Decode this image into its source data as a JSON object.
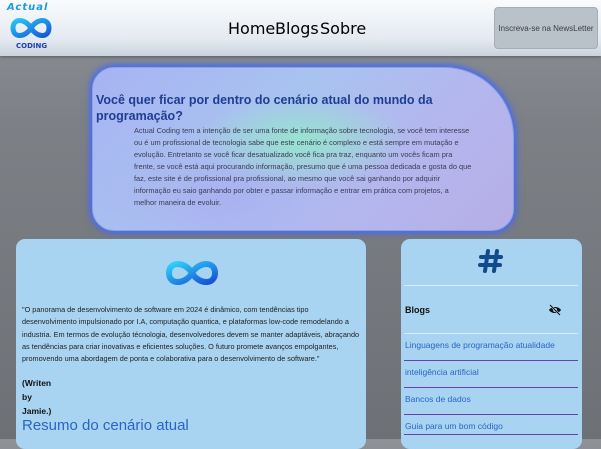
{
  "brand": {
    "name_top": "Actual",
    "name_bottom": "CODING"
  },
  "nav": {
    "home": "Home",
    "blogs": "Blogs",
    "sobre": "Sobre"
  },
  "newsletter_button": "Inscreva-se na NewsLetter",
  "hero": {
    "title": "Você quer ficar por dentro do cenário atual do mundo da programação?",
    "text": "Actual Coding tem a intenção de ser uma fonte de informação sobre tecnologia, se você tem interesse ou é um profissional de tecnologia sabe que este cenário é complexo e está sempre em mutação e evolução. Entretanto se você ficar desatualizado você fica pra traz, enquanto um vocês ficam pra frente, se você está aqui procurando informação, presumo que é uma pessoa dedicada e gosta do que faz, este site é de profissional pra profissional, ao mesmo que você sai ganhando por adquirir informação eu saio ganhando por obter e passar informação e entrar em prática com projetos, a melhor maneira de evoluir."
  },
  "article": {
    "quote": "\"O panorama de desenvolvimento de software em 2024 é dinâmico, com tendências tipo desenvolvimento impulsionado por I.A, computação quantica, e plataformas low-code remodelando a industria. Em termos de evolução técnologia, desenvolvedores devem se manter adaptáveis, abraçando as tendências para criar inovativas e eficientes soluções. O futuro promete avanços empolgantes, promovendo uma abordagem de ponta e colaborativa para o desenvolvimento de software.\"",
    "author_lines": [
      "(Writen",
      "by",
      "Jamie.)"
    ],
    "heading": "Resumo do cenário atual"
  },
  "sidebar": {
    "blogs_label": "Blogs",
    "links": [
      "Linguagens de programação atualidade",
      "inteligência artificial",
      "Bancos de dados",
      "Guia para um bom código"
    ]
  },
  "colors": {
    "accent_blue": "#2a64c7",
    "title_blue": "#1f3d92",
    "card_bg": "#a8d4f1",
    "separator_purple": "#6c3fb0",
    "glow": "#4b6ef0"
  },
  "icons": [
    "infinity-logo-icon",
    "hashtag-icon",
    "eye-slash-icon"
  ]
}
